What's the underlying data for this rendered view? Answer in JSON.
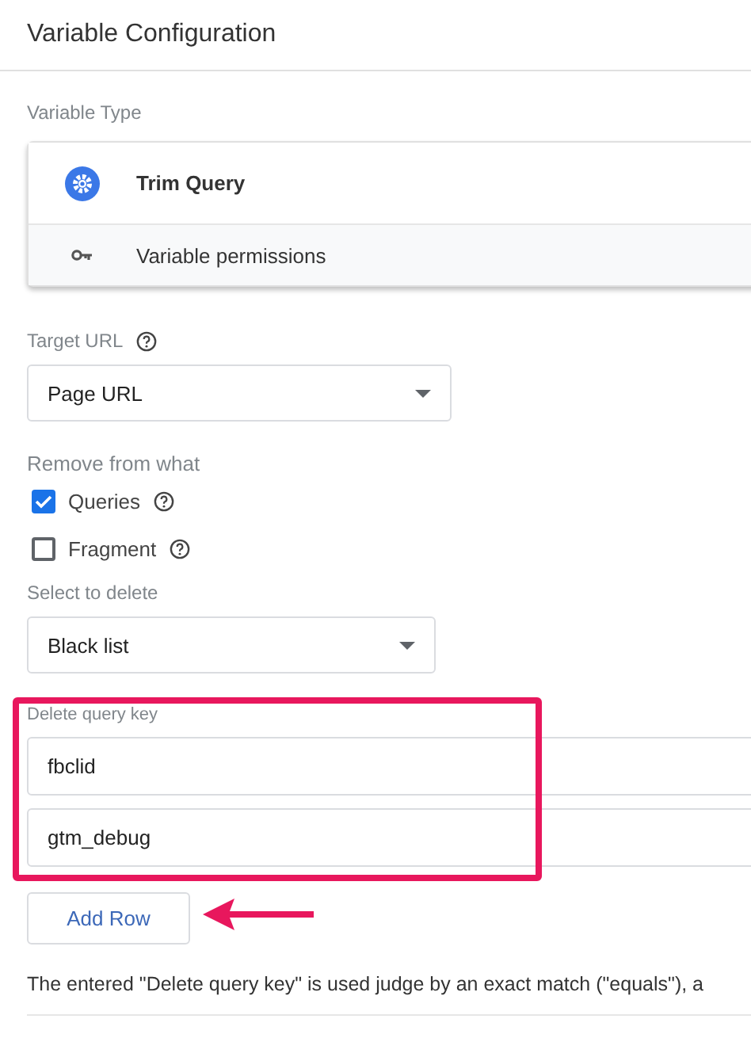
{
  "header": {
    "title": "Variable Configuration"
  },
  "variable_type": {
    "label": "Variable Type",
    "name": "Trim Query",
    "permissions": "Variable permissions"
  },
  "target_url": {
    "label": "Target URL",
    "value": "Page URL"
  },
  "remove_from": {
    "label": "Remove from what",
    "options": [
      {
        "label": "Queries",
        "checked": true
      },
      {
        "label": "Fragment",
        "checked": false
      }
    ]
  },
  "select_to_delete": {
    "label": "Select to delete",
    "value": "Black list"
  },
  "delete_query_key": {
    "label": "Delete query key",
    "rows": [
      "fbclid",
      "gtm_debug"
    ]
  },
  "add_row_button": "Add Row",
  "note": "The entered \"Delete query key\" is used judge by an exact match (\"equals\"), a"
}
